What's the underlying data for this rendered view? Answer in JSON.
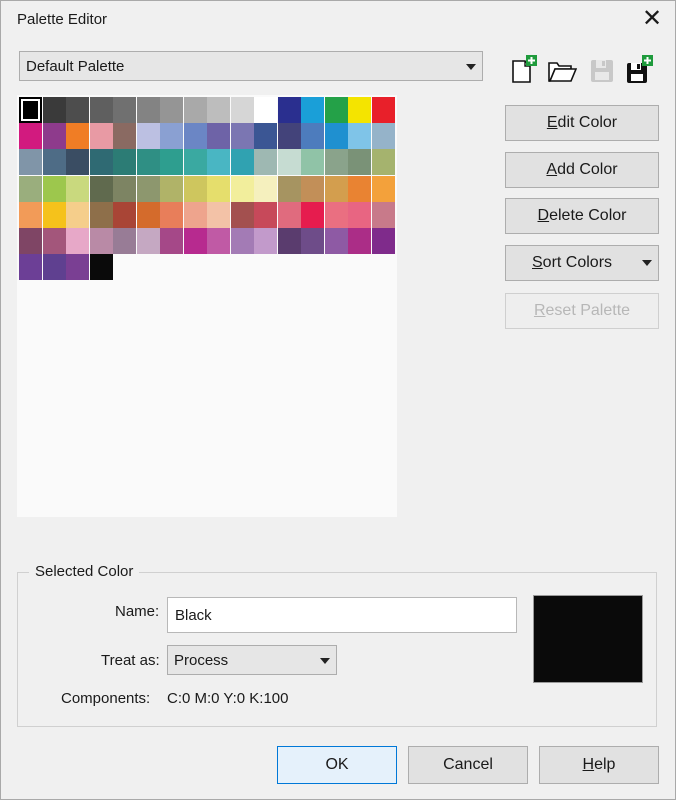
{
  "dialog": {
    "title": "Palette Editor"
  },
  "palette_select": {
    "value": "Default Palette"
  },
  "toolbar": {
    "new_icon": "new-palette-icon",
    "open_icon": "open-folder-icon",
    "save_icon": "save-icon",
    "save_as_icon": "save-as-icon",
    "accent_color": "#1f9b3c"
  },
  "buttons": {
    "edit_color": {
      "mnemonic": "E",
      "rest": "dit Color"
    },
    "add_color": {
      "mnemonic": "A",
      "rest": "dd Color"
    },
    "delete_color": {
      "mnemonic": "D",
      "rest": "elete Color"
    },
    "sort_colors": {
      "mnemonic": "S",
      "rest": "ort Colors"
    },
    "reset_palette": {
      "mnemonic": "R",
      "rest": "eset Palette"
    }
  },
  "swatches": [
    [
      "#000000",
      "#3a3a3a",
      "#4d4d4d",
      "#5f5f5f",
      "#707070",
      "#838383",
      "#959595",
      "#a9a9a9",
      "#bdbdbd",
      "#d6d6d6",
      "#ffffff",
      "#2a2f8f",
      "#1a9fd8",
      "#24a148",
      "#f4e400",
      "#e8202a"
    ],
    [
      "#d21a7f",
      "#8e3b8c",
      "#f07d25",
      "#e89aa4",
      "#8a6a62",
      "#bcc0e2",
      "#8aa0d2",
      "#6b86c5",
      "#6e63a7",
      "#7b76b2",
      "#3b5694",
      "#43437a",
      "#4d7cbd",
      "#1f90d0",
      "#7fc4e8",
      "#95b3c9"
    ],
    [
      "#8095a8",
      "#4e6c86",
      "#3a4d63",
      "#2f6a73",
      "#2c7c75",
      "#2f8f84",
      "#2e9e8f",
      "#3aa9a1",
      "#49b6c3",
      "#30a2b1",
      "#9eb8b2",
      "#c6dcd2",
      "#90c3a7",
      "#8aa38b",
      "#7a9277",
      "#a5b36e"
    ],
    [
      "#9aae7d",
      "#9dc74d",
      "#c9d97e",
      "#606a4e",
      "#7d8463",
      "#8d976e",
      "#b0b368",
      "#cec65e",
      "#e5de6c",
      "#f2ee9c",
      "#f5f0be",
      "#a69461",
      "#c28f58",
      "#d39e4e",
      "#e98332",
      "#f3a13b"
    ],
    [
      "#f29b58",
      "#f5c21b",
      "#f5ce8b",
      "#8e6f4a",
      "#a94536",
      "#d46b2c",
      "#e87e5a",
      "#eea48d",
      "#f3c2a7",
      "#a3504f",
      "#c7495a",
      "#e06b7e",
      "#e61c4e",
      "#ea6f81",
      "#e86582",
      "#c87a8a"
    ],
    [
      "#7f4565",
      "#a3567b",
      "#e7a8c8",
      "#b98aa6",
      "#987c96",
      "#c5a8c2",
      "#a54888",
      "#b72a8f",
      "#c05aa5",
      "#a37bb5",
      "#c29acb",
      "#5a3c6e",
      "#6e4c89",
      "#8e5aa4",
      "#ab2d87",
      "#7f2b8b"
    ],
    [
      "#6c3f96",
      "#5f4090",
      "#7a3f93",
      "#0a0a0a"
    ]
  ],
  "selected_color": {
    "group_label": "Selected Color",
    "name_label": "Name:",
    "name_value": "Black",
    "treat_label": "Treat as:",
    "treat_value": "Process",
    "components_label": "Components:",
    "components_value": "C:0 M:0 Y:0 K:100",
    "preview_color": "#0a0a0a"
  },
  "footer": {
    "ok": "OK",
    "cancel": "Cancel",
    "help_mnemonic": "H",
    "help_rest": "elp"
  }
}
